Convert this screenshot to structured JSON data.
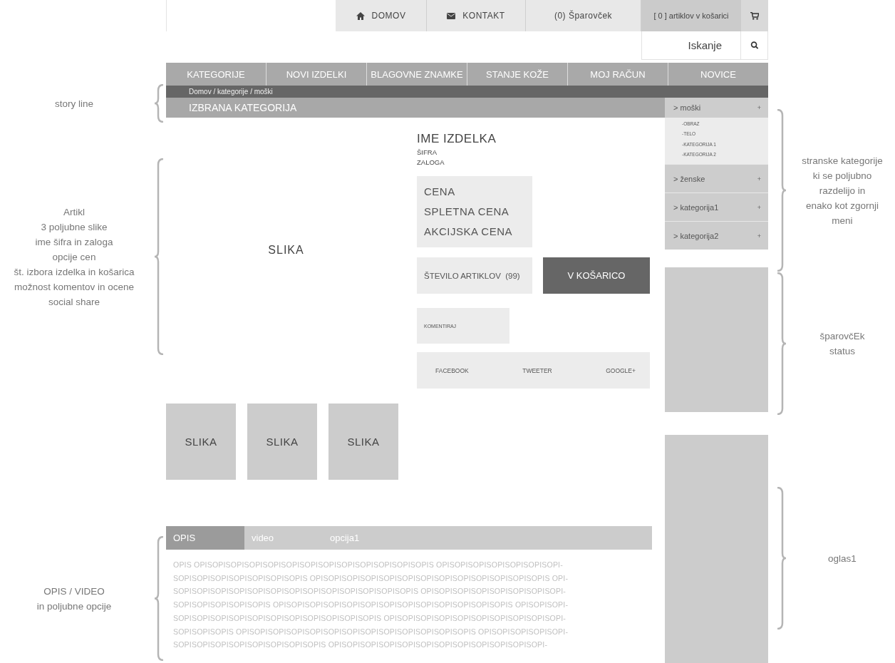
{
  "top_bar": {
    "links": [
      {
        "kind": "home",
        "label": "DOMOV"
      },
      {
        "kind": "mail",
        "label": "KONTAKT"
      },
      {
        "kind": "plain",
        "label": "(0) Šparovček"
      }
    ],
    "cart": {
      "label": "[ 0 ] artiklov v košarici"
    }
  },
  "search": {
    "placeholder": "Iskanje"
  },
  "main_nav": [
    "KATEGORIJE",
    "NOVI IZDELKI",
    "BLAGOVNE ZNAMKE",
    "STANJE KOŽE",
    "MOJ RAČUN",
    "NOVICE"
  ],
  "breadcrumb": "Domov / kategorije / moški",
  "category_title": "IZBRANA KATEGORIJA",
  "product": {
    "image_label": "SLIKA",
    "name": "IME IZDELKA",
    "code": "ŠIFRA",
    "stock": "ZALOGA",
    "prices": [
      "CENA",
      "SPLETNA CENA",
      "AKCIJSKA CENA"
    ],
    "quantity": "ŠTEVILO ARTIKLOV  (99)",
    "add_to_cart": "V KOŠARICO",
    "comment": "KOMENTIRAJ",
    "share": [
      "FACEBOOK",
      "TWEETER",
      "GOOGLE+"
    ],
    "thumbnails": [
      "SLIKA",
      "SLIKA",
      "SLIKA"
    ]
  },
  "tabs": [
    {
      "label": "OPIS",
      "selected": true
    },
    {
      "label": "video",
      "selected": false
    },
    {
      "label": "opcija1",
      "selected": false
    }
  ],
  "description": [
    "OPIS OPISOPISOPISOPISOPISOPISOPISOPISOPISOPISOPISOPISOPIS OPISOPISOPISOPISOPISOPISOPI-",
    "SOPISOPISOPISOPISOPISOPISOPIS OPISOPISOPISOPISOPISOPISOPISOPISOPISOPISOPISOPISOPIS OPI-",
    "SOPISOPISOPISOPISOPISOPISOPISOPISOPISOPISOPISOPISOPIS OPISOPISOPISOPISOPISOPISOPISOPI-",
    "SOPISOPISOPISOPISOPIS OPISOPISOPISOPISOPISOPISOPISOPISOPISOPISOPISOPISOPIS OPISOPISOPI-",
    "SOPISOPISOPISOPISOPISOPISOPISOPISOPISOPISOPIS OPISOPISOPISOPISOPISOPISOPISOPISOPISOPI-",
    "SOPISOPISOPIS OPISOPISOPISOPISOPISOPISOPISOPISOPISOPISOPISOPISOPIS OPISOPISOPISOPISOPI-",
    "SOPISOPISOPISOPISOPISOPISOPISOPIS OPISOPISOPISOPISOPISOPISOPISOPISOPISOPISOPISOPI-"
  ],
  "sidebar": {
    "categories": [
      {
        "label": "> moški",
        "toggle": "+",
        "children": [
          "-OBRAZ",
          "-TELO",
          "-KATEGORIJA 1",
          "-KATEGORIJA 2"
        ]
      },
      {
        "label": "> ženske",
        "toggle": "+"
      },
      {
        "label": "> kategorija1",
        "toggle": "+"
      },
      {
        "label": "> kategorija2",
        "toggle": "+"
      }
    ]
  },
  "annotations": {
    "left": [
      {
        "lines": [
          "story line"
        ]
      },
      {
        "lines": [
          "Artikl",
          "3 poljubne slike",
          "ime šifra in zaloga",
          "opcije cen",
          "št. izbora izdelka in košarica",
          "možnost komentov in ocene",
          "social share"
        ]
      },
      {
        "lines": [
          "OPIS / VIDEO",
          "in poljubne opcije"
        ]
      }
    ],
    "right": [
      {
        "lines": [
          "stranske kategorije",
          "ki se poljubno",
          "razdelijo in",
          "enako kot zgornji",
          "meni"
        ]
      },
      {
        "lines": [
          "šparovčEk",
          "status"
        ]
      },
      {
        "lines": [
          "oglas1"
        ]
      }
    ]
  }
}
